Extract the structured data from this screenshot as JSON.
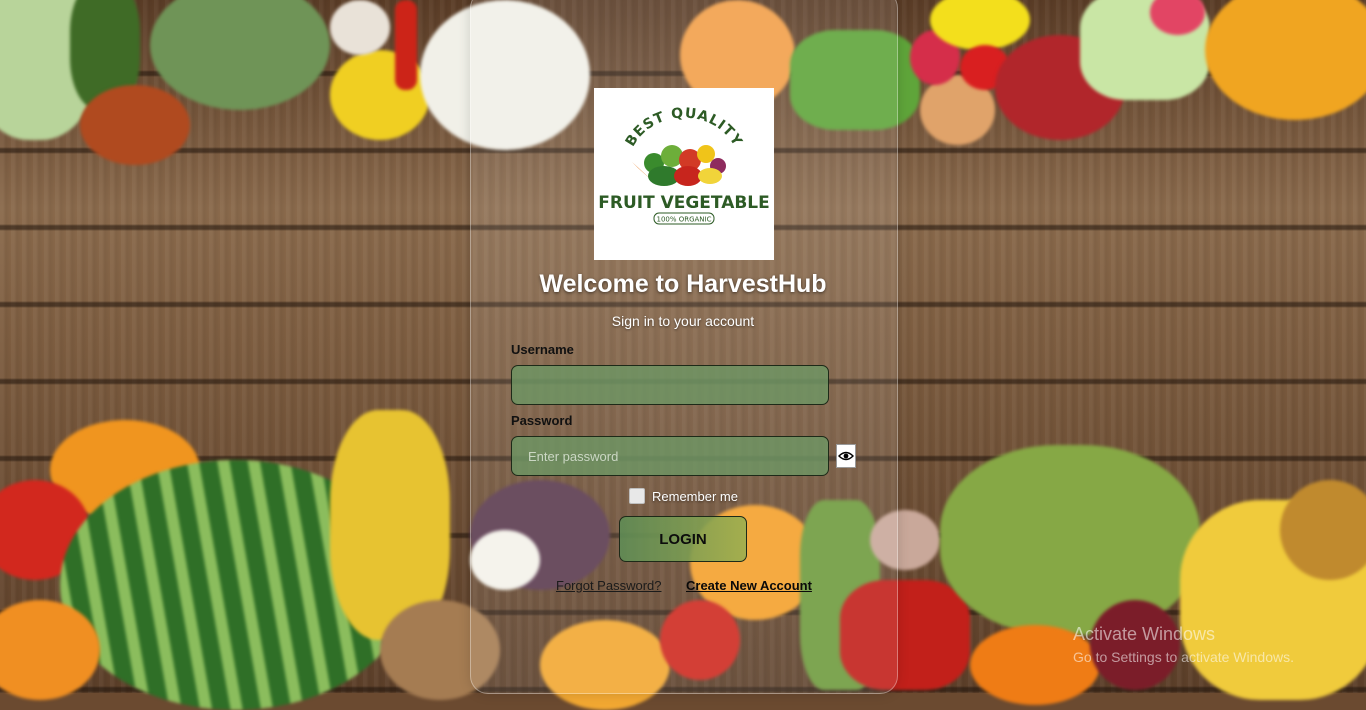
{
  "app": {
    "logo_text": {
      "top": "BEST QUALITY",
      "main": "FRUIT VEGETABLE",
      "badge": "100% ORGANIC"
    },
    "title": "Welcome to HarvestHub",
    "subtitle": "Sign in to your account"
  },
  "form": {
    "username_label": "Username",
    "username_value": "",
    "password_label": "Password",
    "password_placeholder": "Enter password",
    "show_password_icon": "eye-icon",
    "remember_label": "Remember me",
    "remember_checked": false,
    "login_label": "LOGIN",
    "forgot_link": "Forgot Password?",
    "create_link": "Create New Account"
  },
  "os_watermark": {
    "line1": "Activate Windows",
    "line2": "Go to Settings to activate Windows."
  },
  "colors": {
    "field_bg": "#6e9664",
    "card_border": "#ffffff",
    "title": "#ffffff"
  }
}
